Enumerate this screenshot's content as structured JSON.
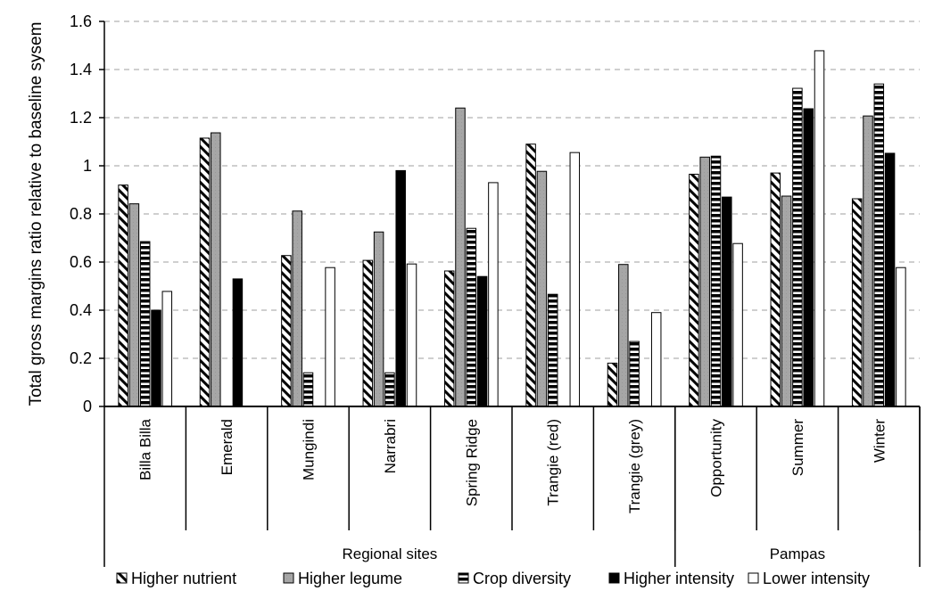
{
  "chart_data": {
    "type": "bar",
    "title": "",
    "xlabel": "",
    "ylabel": "Total gross margins ratio relative to baseline sysem",
    "ylim": [
      0,
      1.6
    ],
    "yticks": [
      0,
      0.2,
      0.4,
      0.6,
      0.8,
      1,
      1.2,
      1.4,
      1.6
    ],
    "ytick_labels": [
      "0",
      "0.2",
      "0.4",
      "0.6",
      "0.8",
      "1",
      "1.2",
      "1.4",
      "1.6"
    ],
    "grid": "horizontal dashed",
    "legend_position": "bottom",
    "categories": [
      "Billa Billa",
      "Emerald",
      "Mungindi",
      "Narrabri",
      "Spring Ridge",
      "Trangie  (red)",
      "Trangie (grey)",
      "Opportunity",
      "Summer",
      "Winter"
    ],
    "category_groups": [
      {
        "label": "Regional sites",
        "count": 7
      },
      {
        "label": "Pampas",
        "count": 3
      }
    ],
    "series": [
      {
        "name": "Higher nutrient",
        "pattern": "diagonal-hatch",
        "values": [
          0.92,
          1.115,
          0.627,
          0.607,
          0.563,
          1.09,
          0.18,
          0.965,
          0.97,
          0.863
        ]
      },
      {
        "name": "Higher legume",
        "pattern": "grey-fill",
        "color": "#a6a6a6",
        "values": [
          0.842,
          1.137,
          0.812,
          0.725,
          1.24,
          0.977,
          0.59,
          1.036,
          0.874,
          1.207
        ]
      },
      {
        "name": "Crop diversity",
        "pattern": "horizontal-stripes",
        "values": [
          0.685,
          null,
          0.14,
          0.14,
          0.74,
          0.466,
          0.27,
          1.04,
          1.322,
          1.34
        ]
      },
      {
        "name": "Higher intensity",
        "pattern": "black-fill",
        "color": "#000000",
        "values": [
          0.4,
          0.53,
          null,
          0.98,
          0.54,
          null,
          null,
          0.87,
          1.237,
          1.052
        ]
      },
      {
        "name": "Lower intensity",
        "pattern": "white-fill",
        "color": "#ffffff",
        "values": [
          0.478,
          null,
          0.577,
          0.592,
          0.93,
          1.055,
          0.39,
          0.677,
          1.478,
          0.577
        ]
      }
    ]
  }
}
